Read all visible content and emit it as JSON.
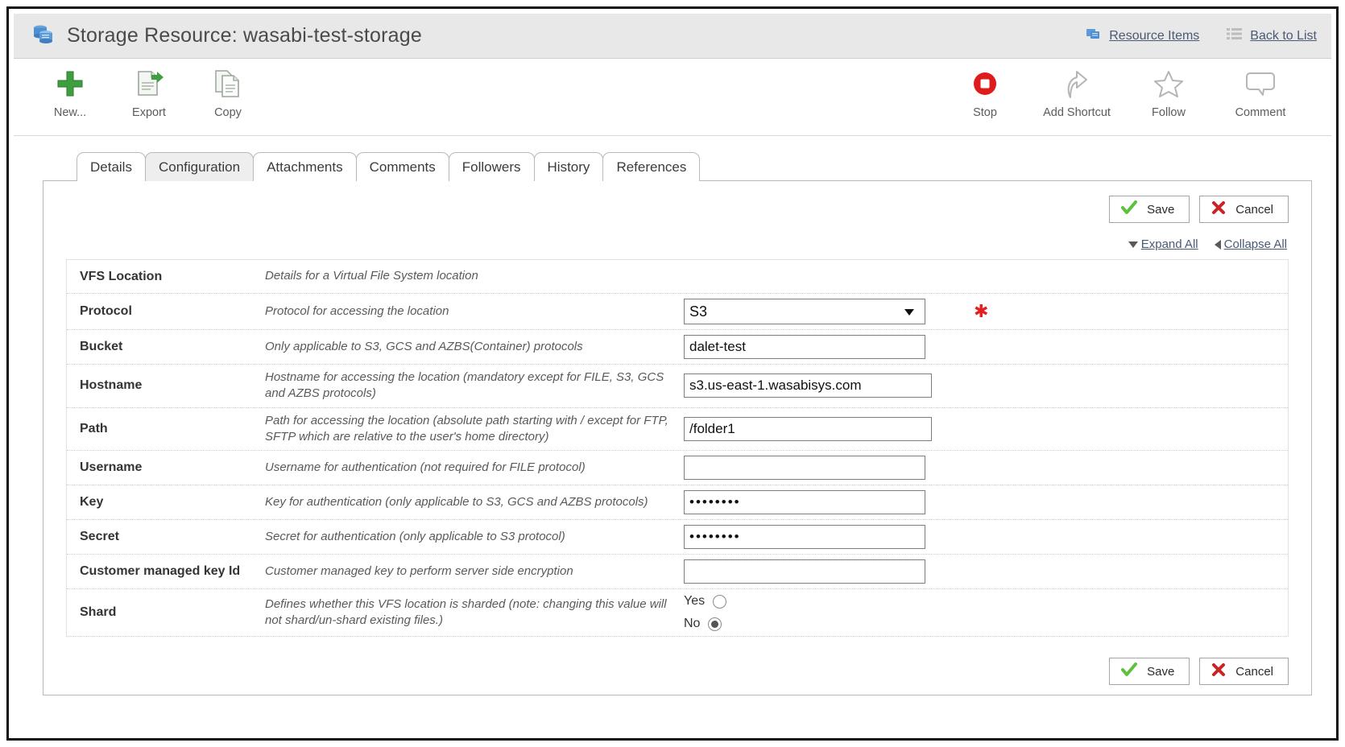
{
  "header": {
    "icon": "storage-resource-icon",
    "title": "Storage Resource: wasabi-test-storage",
    "links": [
      {
        "icon": "resource-items-icon",
        "label": "Resource Items"
      },
      {
        "icon": "list-icon",
        "label": "Back to List"
      }
    ]
  },
  "toolbar": {
    "left": [
      {
        "icon": "plus-icon",
        "label": "New..."
      },
      {
        "icon": "export-icon",
        "label": "Export"
      },
      {
        "icon": "copy-icon",
        "label": "Copy"
      }
    ],
    "right": [
      {
        "icon": "stop-icon",
        "label": "Stop"
      },
      {
        "icon": "add-shortcut-icon",
        "label": "Add Shortcut"
      },
      {
        "icon": "star-icon",
        "label": "Follow"
      },
      {
        "icon": "comment-icon",
        "label": "Comment"
      }
    ]
  },
  "tabs": [
    {
      "label": "Details",
      "active": false
    },
    {
      "label": "Configuration",
      "active": true
    },
    {
      "label": "Attachments",
      "active": false
    },
    {
      "label": "Comments",
      "active": false
    },
    {
      "label": "Followers",
      "active": false
    },
    {
      "label": "History",
      "active": false
    },
    {
      "label": "References",
      "active": false
    }
  ],
  "actions": {
    "save_label": "Save",
    "cancel_label": "Cancel",
    "expand_all_label": "Expand All",
    "collapse_all_label": "Collapse All"
  },
  "colors": {
    "save_check": "#5cc13c",
    "cancel_x": "#cc2222",
    "required_star": "#e22020",
    "link": "#4a5a75",
    "stop_red": "#e01b1b"
  },
  "form": {
    "rows": [
      {
        "name": "VFS Location",
        "description": "Details for a Virtual File System location",
        "control": "none",
        "value": "",
        "required": false
      },
      {
        "name": "Protocol",
        "description": "Protocol for accessing the location",
        "control": "select",
        "value": "S3",
        "options": [
          "S3"
        ],
        "required": true
      },
      {
        "name": "Bucket",
        "description": "Only applicable to S3, GCS and AZBS(Container) protocols",
        "control": "text",
        "value": "dalet-test",
        "required": false
      },
      {
        "name": "Hostname",
        "description": "Hostname for accessing the location (mandatory except for FILE, S3, GCS and AZBS protocols)",
        "control": "text",
        "value": "s3.us-east-1.wasabisys.com",
        "required": false
      },
      {
        "name": "Path",
        "description": "Path for accessing the location (absolute path starting with / except for FTP, SFTP which are relative to the user's home directory)",
        "control": "text",
        "value": "/folder1",
        "required": false
      },
      {
        "name": "Username",
        "description": "Username for authentication (not required for FILE protocol)",
        "control": "text",
        "value": "",
        "required": false
      },
      {
        "name": "Key",
        "description": "Key for authentication (only applicable to S3, GCS and AZBS protocols)",
        "control": "password",
        "value": "••••••••",
        "required": false
      },
      {
        "name": "Secret",
        "description": "Secret for authentication (only applicable to S3 protocol)",
        "control": "password",
        "value": "••••••••",
        "required": false
      },
      {
        "name": "Customer managed key Id",
        "description": "Customer managed key to perform server side encryption",
        "control": "text",
        "value": "",
        "required": false
      },
      {
        "name": "Shard",
        "description": "Defines whether this VFS location is sharded (note: changing this value will not shard/un-shard existing files.)",
        "control": "radio",
        "value": "No",
        "options": [
          "Yes",
          "No"
        ],
        "required": false
      }
    ]
  }
}
